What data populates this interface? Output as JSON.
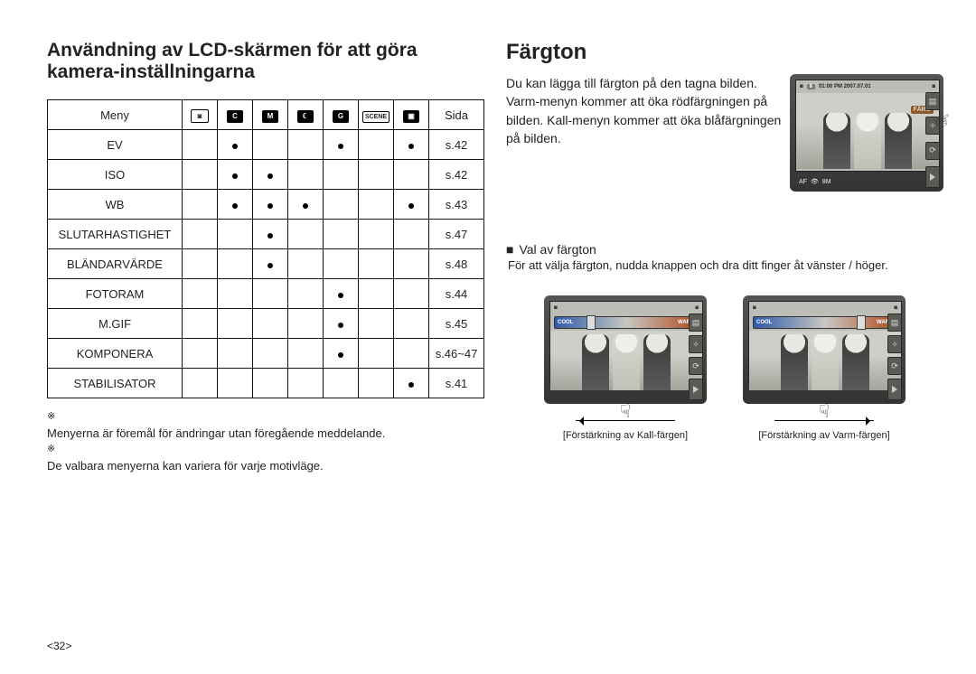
{
  "page_number": "<32>",
  "left": {
    "heading": "Användning av LCD-skärmen för att göra kamera-inställningarna",
    "table": {
      "header_first": "Meny",
      "header_last": "Sida",
      "mode_icons": [
        "camera-icon",
        "cplus-icon",
        "m-icon",
        "night-icon",
        "gplus-icon",
        "scene",
        "movie-icon"
      ],
      "scene_label": "SCENE",
      "rows": [
        {
          "meny": "EV",
          "dots": [
            0,
            1,
            0,
            0,
            1,
            0,
            1
          ],
          "sida": "s.42"
        },
        {
          "meny": "ISO",
          "dots": [
            0,
            1,
            1,
            0,
            0,
            0,
            0
          ],
          "sida": "s.42"
        },
        {
          "meny": "WB",
          "dots": [
            0,
            1,
            1,
            1,
            0,
            0,
            1
          ],
          "sida": "s.43"
        },
        {
          "meny": "SLUTARHASTIGHET",
          "dots": [
            0,
            0,
            1,
            0,
            0,
            0,
            0
          ],
          "sida": "s.47"
        },
        {
          "meny": "BLÄNDARVÄRDE",
          "dots": [
            0,
            0,
            1,
            0,
            0,
            0,
            0
          ],
          "sida": "s.48"
        },
        {
          "meny": "FOTORAM",
          "dots": [
            0,
            0,
            0,
            0,
            1,
            0,
            0
          ],
          "sida": "s.44"
        },
        {
          "meny": "M.GIF",
          "dots": [
            0,
            0,
            0,
            0,
            1,
            0,
            0
          ],
          "sida": "s.45"
        },
        {
          "meny": "KOMPONERA",
          "dots": [
            0,
            0,
            0,
            0,
            1,
            0,
            0
          ],
          "sida": "s.46~47"
        },
        {
          "meny": "STABILISATOR",
          "dots": [
            0,
            0,
            0,
            0,
            0,
            0,
            1
          ],
          "sida": "s.41"
        }
      ]
    },
    "notes": [
      "Menyerna är föremål för ändringar utan föregående meddelande.",
      "De valbara menyerna kan variera för varje motivläge."
    ],
    "note_marker": "※"
  },
  "right": {
    "heading": "Färgton",
    "desc": "Du kan lägga till färgton på den tagna bilden. Varm-menyn kommer att öka rödfärgningen på bilden. Kall-menyn kommer att öka blåfärgningen på bilden.",
    "lcd_main": {
      "status_left": "8",
      "status_time": "01:00 PM 2007.07.01",
      "farg_label": "FÄRG",
      "bottom_left": "AF",
      "bottom_eye": "👁",
      "bottom_value": "8M"
    },
    "sub_heading": "Val av färgton",
    "sub_text": "För att välja färgton, nudda knappen och dra ditt finger åt vänster / höger.",
    "slider": {
      "left_label": "COOL",
      "right_label": "WARM"
    },
    "example_left_caption": "[Förstärkning av Kall-färgen]",
    "example_right_caption": "[Förstärkning av Varm-färgen]"
  }
}
